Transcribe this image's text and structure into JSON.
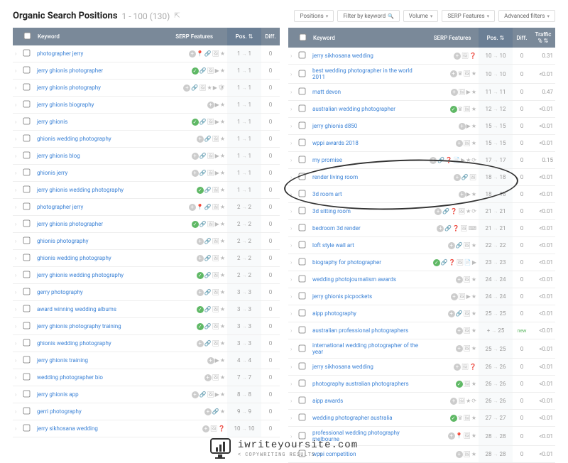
{
  "header": {
    "title": "Organic Search Positions",
    "range": "1 - 100 (130)"
  },
  "filters": {
    "positions": "Positions",
    "filter_kw": "Filter by keyword",
    "volume": "Volume",
    "serp": "SERP Features",
    "adv": "Advanced filters"
  },
  "th": {
    "keyword": "Keyword",
    "serp": "SERP Features",
    "pos": "Pos.",
    "diff": "Diff.",
    "traffic": "Traffic %"
  },
  "left": [
    {
      "kw": "photographer jerry",
      "icons": [
        "plus",
        "pin",
        "link",
        "img",
        "star"
      ],
      "p1": "1",
      "p2": "1",
      "d": "0"
    },
    {
      "kw": "jerry ghionis photographer",
      "icons": [
        "check",
        "link",
        "img",
        "cam",
        "star"
      ],
      "p1": "1",
      "p2": "1",
      "d": "0"
    },
    {
      "kw": "jerry ghionis photography",
      "icons": [
        "plus",
        "link",
        "img",
        "star",
        "cam",
        "sh"
      ],
      "p1": "1",
      "p2": "1",
      "d": "0"
    },
    {
      "kw": "jerry ghionis biography",
      "icons": [
        "plus",
        "cam",
        "star"
      ],
      "p1": "1",
      "p2": "1",
      "d": "0"
    },
    {
      "kw": "jerry ghionis",
      "icons": [
        "check",
        "link",
        "img",
        "cam",
        "star"
      ],
      "p1": "1",
      "p2": "1",
      "d": "0"
    },
    {
      "kw": "ghionis wedding photography",
      "icons": [
        "plus",
        "link",
        "img",
        "star"
      ],
      "p1": "1",
      "p2": "1",
      "d": "0"
    },
    {
      "kw": "jerry ghionis blog",
      "icons": [
        "plus",
        "link",
        "img",
        "cam",
        "star"
      ],
      "p1": "1",
      "p2": "1",
      "d": "0"
    },
    {
      "kw": "ghionis jerry",
      "icons": [
        "plus",
        "link",
        "img",
        "cam",
        "star"
      ],
      "p1": "1",
      "p2": "1",
      "d": "0"
    },
    {
      "kw": "jerry ghionis wedding photography",
      "icons": [
        "check",
        "link",
        "img",
        "star"
      ],
      "p1": "1",
      "p2": "1",
      "d": "0"
    },
    {
      "kw": "photographer jerry",
      "icons": [
        "plus",
        "pin",
        "link",
        "img",
        "star"
      ],
      "p1": "2",
      "p2": "2",
      "d": "0"
    },
    {
      "kw": "jerry ghionis photographer",
      "icons": [
        "check",
        "link",
        "img",
        "cam",
        "star"
      ],
      "p1": "2",
      "p2": "2",
      "d": "0"
    },
    {
      "kw": "ghionis photography",
      "icons": [
        "plus",
        "link",
        "img",
        "star"
      ],
      "p1": "2",
      "p2": "2",
      "d": "0"
    },
    {
      "kw": "ghionis wedding photography",
      "icons": [
        "plus",
        "link",
        "img",
        "star"
      ],
      "p1": "2",
      "p2": "2",
      "d": "0"
    },
    {
      "kw": "jerry ghionis wedding photography",
      "icons": [
        "check",
        "link",
        "img",
        "star"
      ],
      "p1": "2",
      "p2": "2",
      "d": "0"
    },
    {
      "kw": "gerry photography",
      "icons": [
        "plus",
        "link",
        "img",
        "star"
      ],
      "p1": "3",
      "p2": "3",
      "d": "0"
    },
    {
      "kw": "award winning wedding albums",
      "icons": [
        "check",
        "link",
        "img",
        "star"
      ],
      "p1": "3",
      "p2": "3",
      "d": "0"
    },
    {
      "kw": "jerry ghionis photography training",
      "icons": [
        "check",
        "link",
        "img",
        "star"
      ],
      "p1": "3",
      "p2": "3",
      "d": "0"
    },
    {
      "kw": "ghionis wedding photography",
      "icons": [
        "plus",
        "link",
        "img",
        "star"
      ],
      "p1": "3",
      "p2": "3",
      "d": "0"
    },
    {
      "kw": "jerry ghionis training",
      "icons": [
        "plus",
        "cam",
        "star"
      ],
      "p1": "4",
      "p2": "4",
      "d": "0"
    },
    {
      "kw": "wedding photographer bio",
      "icons": [
        "plus",
        "img",
        "star"
      ],
      "p1": "7",
      "p2": "7",
      "d": "0"
    },
    {
      "kw": "jerry ghionis app",
      "icons": [
        "plus",
        "link",
        "img",
        "cam",
        "star"
      ],
      "p1": "8",
      "p2": "8",
      "d": "0"
    },
    {
      "kw": "gerri photography",
      "icons": [
        "plus",
        "link",
        "star"
      ],
      "p1": "9",
      "p2": "9",
      "d": "0"
    },
    {
      "kw": "jerry sikhosana wedding",
      "icons": [
        "plus",
        "img",
        "q"
      ],
      "p1": "10",
      "p2": "10",
      "d": "0"
    }
  ],
  "right": [
    {
      "kw": "jerry sikhosana wedding",
      "icons": [
        "plus",
        "img",
        "q"
      ],
      "p1": "10",
      "p2": "10",
      "d": "0",
      "t": "0.31"
    },
    {
      "kw": "best wedding photographer in the world 2011",
      "icons": [
        "plus",
        "cr",
        "img",
        "star"
      ],
      "p1": "10",
      "p2": "10",
      "d": "0",
      "t": "<0.01"
    },
    {
      "kw": "matt devon",
      "icons": [
        "plus",
        "img",
        "cam",
        "star"
      ],
      "p1": "11",
      "p2": "11",
      "d": "0",
      "t": "0.47"
    },
    {
      "kw": "australian wedding photographer",
      "icons": [
        "check",
        "cr",
        "img",
        "star"
      ],
      "p1": "12",
      "p2": "12",
      "d": "0",
      "t": "<0.01"
    },
    {
      "kw": "jerry ghionis d850",
      "icons": [
        "plus",
        "cam",
        "star"
      ],
      "p1": "15",
      "p2": "15",
      "d": "0",
      "t": "<0.01"
    },
    {
      "kw": "wppi awards 2018",
      "icons": [
        "plus",
        "img",
        "star"
      ],
      "p1": "15",
      "p2": "15",
      "d": "0",
      "t": "<0.01"
    },
    {
      "kw": "my promise",
      "icons": [
        "plus",
        "link",
        "q",
        "doc",
        "cam",
        "star",
        "r"
      ],
      "p1": "17",
      "p2": "17",
      "d": "0",
      "t": "0.15"
    },
    {
      "kw": "render living room",
      "icons": [
        "plus",
        "link",
        "img"
      ],
      "p1": "18",
      "p2": "18",
      "d": "0",
      "t": "<0.01"
    },
    {
      "kw": "3d room art",
      "icons": [
        "plus",
        "cam",
        "star"
      ],
      "p1": "18",
      "p2": "18",
      "d": "0",
      "t": "<0.01"
    },
    {
      "kw": "3d sitting room",
      "icons": [
        "plus",
        "link",
        "q",
        "img",
        "star",
        "r"
      ],
      "p1": "21",
      "p2": "21",
      "d": "0",
      "t": "<0.01"
    },
    {
      "kw": "bedroom 3d render",
      "icons": [
        "plus",
        "link",
        "q",
        "img",
        "kb"
      ],
      "p1": "21",
      "p2": "21",
      "d": "0",
      "t": "<0.01"
    },
    {
      "kw": "loft style wall art",
      "icons": [
        "plus",
        "link",
        "img",
        "star"
      ],
      "p1": "22",
      "p2": "22",
      "d": "0",
      "t": "<0.01"
    },
    {
      "kw": "biography for photographer",
      "icons": [
        "check",
        "link",
        "q",
        "img",
        "doc",
        "cam"
      ],
      "p1": "23",
      "p2": "23",
      "d": "0",
      "t": "<0.01"
    },
    {
      "kw": "wedding photojournalism awards",
      "icons": [
        "plus",
        "img",
        "star"
      ],
      "p1": "24",
      "p2": "24",
      "d": "0",
      "t": "<0.01"
    },
    {
      "kw": "jerry ghionis picpockets",
      "icons": [
        "plus",
        "img",
        "cam",
        "star"
      ],
      "p1": "24",
      "p2": "24",
      "d": "0",
      "t": "<0.01"
    },
    {
      "kw": "aipp photography",
      "icons": [
        "plus",
        "link",
        "img",
        "star"
      ],
      "p1": "25",
      "p2": "25",
      "d": "0",
      "t": "<0.01"
    },
    {
      "kw": "australian professional photographers",
      "icons": [
        "plus",
        "img",
        "star"
      ],
      "p1": "+",
      "p2": "25",
      "d": "new",
      "t": "<0.01"
    },
    {
      "kw": "international wedding photographer of the year",
      "icons": [
        "plus",
        "img",
        "star"
      ],
      "p1": "25",
      "p2": "25",
      "d": "0",
      "t": "<0.01"
    },
    {
      "kw": "jerry sikhosana wedding",
      "icons": [
        "plus",
        "img",
        "q"
      ],
      "p1": "26",
      "p2": "26",
      "d": "0",
      "t": "<0.01"
    },
    {
      "kw": "photography australian photographers",
      "icons": [
        "check",
        "img",
        "star"
      ],
      "p1": "26",
      "p2": "26",
      "d": "0",
      "t": "<0.01"
    },
    {
      "kw": "aipp awards",
      "icons": [
        "plus",
        "img",
        "star",
        "r"
      ],
      "p1": "26",
      "p2": "26",
      "d": "0",
      "t": "<0.01"
    },
    {
      "kw": "wedding photographer australia",
      "icons": [
        "check",
        "cr",
        "img",
        "star"
      ],
      "p1": "27",
      "p2": "27",
      "d": "0",
      "t": "<0.01"
    },
    {
      "kw": "professional wedding photography melbourne",
      "icons": [
        "plus",
        "pin",
        "img",
        "star"
      ],
      "p1": "28",
      "p2": "28",
      "d": "0",
      "t": "<0.01"
    },
    {
      "kw": "wppi competition",
      "icons": [
        "plus",
        "img",
        "star"
      ],
      "p1": "28",
      "p2": "28",
      "d": "0",
      "t": "<0.01"
    }
  ],
  "footer": {
    "brand": "iwriteyoursite.com",
    "tagline": "< COPYWRITING RESULTS >"
  }
}
